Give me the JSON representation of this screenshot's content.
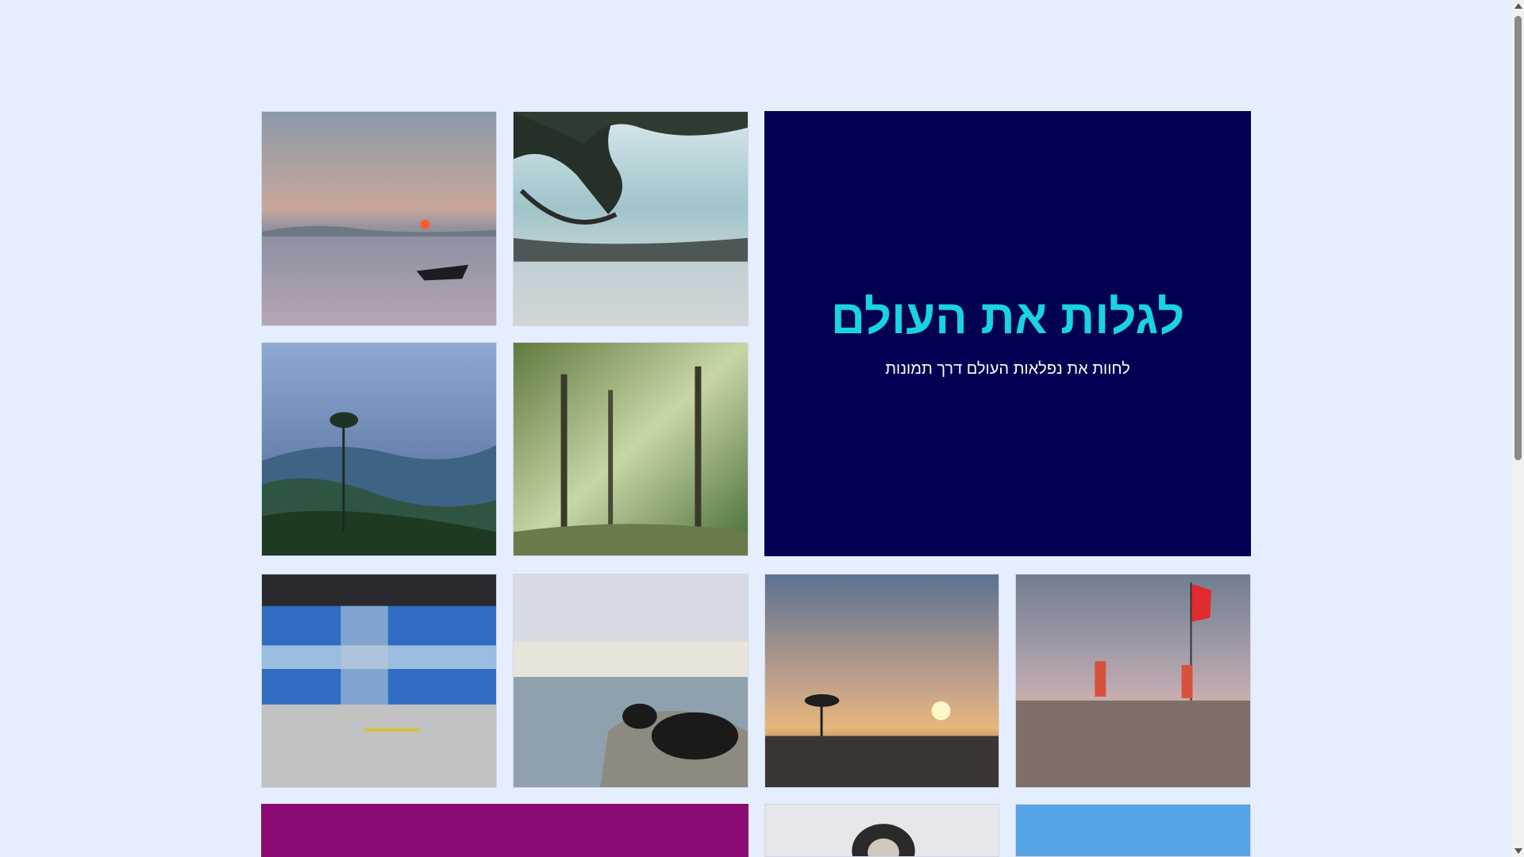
{
  "hero": {
    "title": "לגלות את העולם",
    "subtitle": "לחוות את נפלאות העולם דרך תמונות",
    "background": "#020052",
    "title_color": "#19d4e0"
  },
  "gallery": {
    "photos": [
      {
        "name": "sunset-boat-photo"
      },
      {
        "name": "beach-hammock-photo"
      },
      {
        "name": "misty-mountains-photo"
      },
      {
        "name": "palm-forest-photo"
      },
      {
        "name": "blue-train-photo"
      },
      {
        "name": "lakeside-cow-photo"
      },
      {
        "name": "sunset-trees-photo"
      },
      {
        "name": "beach-flag-photo"
      },
      {
        "name": "monkey-photo"
      },
      {
        "name": "blue-sky-photo"
      }
    ],
    "accent_tile_color": "#8a0b74"
  }
}
